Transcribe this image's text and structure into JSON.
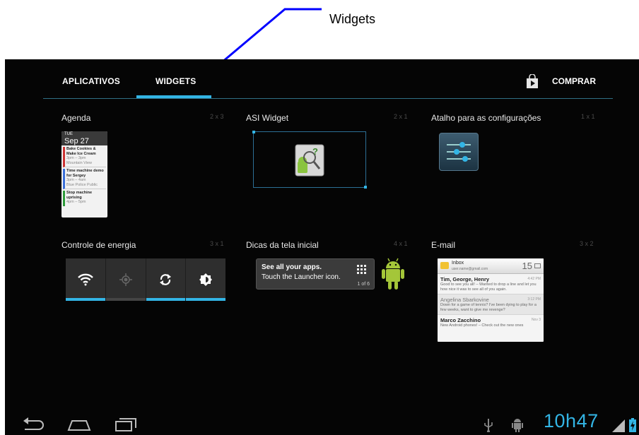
{
  "annotation": {
    "label": "Widgets"
  },
  "tabs": {
    "apps": "APLICATIVOS",
    "widgets": "WIDGETS",
    "store": "COMPRAR"
  },
  "widgets": [
    {
      "title": "Agenda",
      "size": "2 x 3"
    },
    {
      "title": "ASI Widget",
      "size": "2 x 1"
    },
    {
      "title": "Atalho para as configurações",
      "size": "1 x 1"
    },
    {
      "title": "Controle de energia",
      "size": "3 x 1"
    },
    {
      "title": "Dicas da tela inicial",
      "size": "4 x 1"
    },
    {
      "title": "E-mail",
      "size": "3 x 2"
    }
  ],
  "agenda": {
    "day": "TUE",
    "date": "Sep 27",
    "events": [
      {
        "title": "Bake Cookies & Make Ice Cream",
        "time": "3pm – 3pm",
        "place": "Mountain View"
      },
      {
        "title": "Time machine demo for Sergey",
        "time": "3pm – 4am",
        "place": "Blue Police Public"
      },
      {
        "title": "Stop machine uprising",
        "time": "4pm – 5pm",
        "place": ""
      }
    ]
  },
  "tips": {
    "line1": "See all your apps.",
    "line2": "Touch the Launcher icon.",
    "page": "1 of 6"
  },
  "email": {
    "inbox": "Inbox",
    "account": "user.name@gmail.com",
    "count": "15",
    "messages": [
      {
        "sender": "Tim, George, Henry",
        "time": "4:42 PM",
        "snippet": "Good to see you all! – Wanted to drop a line and let you how nice it was to see all of you again.",
        "unread": true
      },
      {
        "sender": "Angelina Sbarkovine",
        "time": "3:12 PM",
        "snippet": "Down for a game of tennis? I've been dying to play for a few weeks, want to give me revenge?",
        "unread": false
      },
      {
        "sender": "Marco Zacchino",
        "time": "Nov 3",
        "snippet": "New Android phones! – Check out the new ones",
        "unread": true
      }
    ]
  },
  "status": {
    "clock_hours": "10",
    "clock_sep": "h",
    "clock_minutes": "47"
  },
  "colors": {
    "accent": "#33b5e5",
    "background": "#050505",
    "annotation_line": "#0000ff"
  }
}
